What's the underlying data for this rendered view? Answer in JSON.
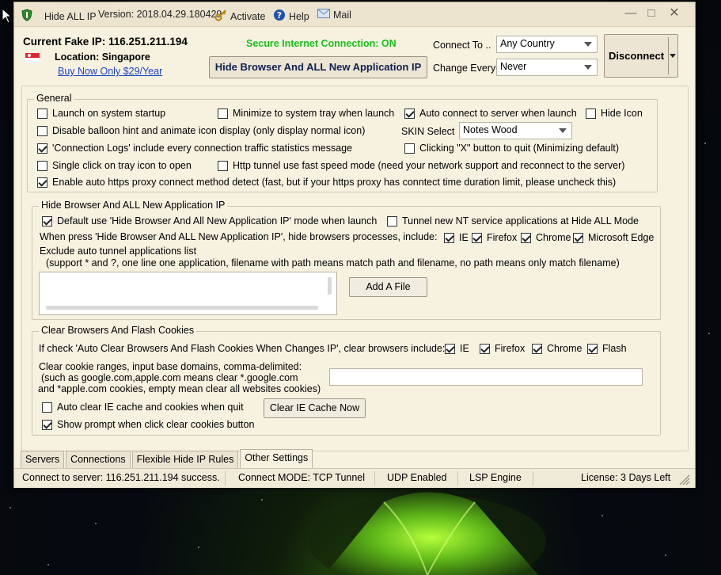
{
  "window": {
    "app_title": "Hide ALL IP",
    "version": "Version: 2018.04.29.180429",
    "activate": "Activate",
    "help": "Help",
    "mail": "Mail"
  },
  "header": {
    "current_ip": "Current Fake IP: 116.251.211.194",
    "location": "Location: Singapore",
    "buy_link": "Buy Now Only $29/Year",
    "secure_status": "Secure Internet Connection: ON",
    "hide_browser_button": "Hide Browser And ALL New Application IP",
    "connect_to_label": "Connect To ..",
    "connect_to_value": "Any Country",
    "change_every_label": "Change Every",
    "change_every_value": "Never",
    "disconnect_button": "Disconnect"
  },
  "general": {
    "title": "General",
    "launch_startup": "Launch on system startup",
    "minimize_tray": "Minimize to system tray when launch",
    "auto_connect": "Auto connect to server when launch",
    "hide_icon": "Hide Icon",
    "disable_balloon": "Disable balloon hint and animate icon display (only display normal icon)",
    "skin_label": "SKIN Select",
    "skin_value": "Notes Wood",
    "connection_logs": "'Connection Logs' include every connection traffic statistics message",
    "clicking_x": "Clicking \"X\" button to quit (Minimizing default)",
    "single_click": "Single click on tray icon to open",
    "http_tunnel": "Http tunnel use fast speed mode (need your network support and reconnect to the server)",
    "auto_https": "Enable auto https proxy connect method detect (fast,  but if your https proxy has conntect time duration limit, please uncheck this)"
  },
  "hide_browser": {
    "title": "Hide Browser And ALL New Application IP",
    "default_use": "Default use 'Hide Browser And All New Application IP' mode when launch",
    "tunnel_nt": "Tunnel new NT service applications at Hide ALL Mode",
    "when_press": "When press 'Hide Browser And ALL New Application IP', hide browsers processes, include:",
    "ie": "IE",
    "firefox": "Firefox",
    "chrome": "Chrome",
    "edge": "Microsoft Edge",
    "exclude_title": "Exclude auto tunnel applications list",
    "exclude_help": "(support * and ?, one line one application, filename with path means match path and filename,  no path means only match filename)",
    "add_file_button": "Add A File"
  },
  "cookies": {
    "title": "Clear Browsers And Flash Cookies",
    "if_check": "If check 'Auto Clear Browsers And Flash Cookies When Changes IP', clear browsers include:",
    "ie": "IE",
    "firefox": "Firefox",
    "chrome": "Chrome",
    "flash": "Flash",
    "ranges_line1": "Clear cookie ranges, input base domains,  comma-delimited:",
    "ranges_line2": "(such as google.com,apple.com means clear *.google.com",
    "ranges_line3": "and *apple.com cookies, empty mean clear all websites cookies)",
    "auto_clear_ie": "Auto clear IE cache and cookies when quit",
    "clear_ie_button": "Clear IE Cache Now",
    "show_prompt": "Show prompt when click clear cookies button"
  },
  "tabs": [
    "Servers",
    "Connections",
    "Flexible Hide IP Rules",
    "Other Settings"
  ],
  "status": {
    "connect": "Connect to server: 116.251.211.194 success.",
    "mode": "Connect MODE: TCP Tunnel",
    "udp": "UDP Enabled",
    "lsp": "LSP Engine",
    "license": "License: 3 Days Left"
  },
  "colors": {
    "window_bg": "#f7f1e0",
    "secure_green": "#18c21a",
    "link_blue": "#1a44c4"
  }
}
